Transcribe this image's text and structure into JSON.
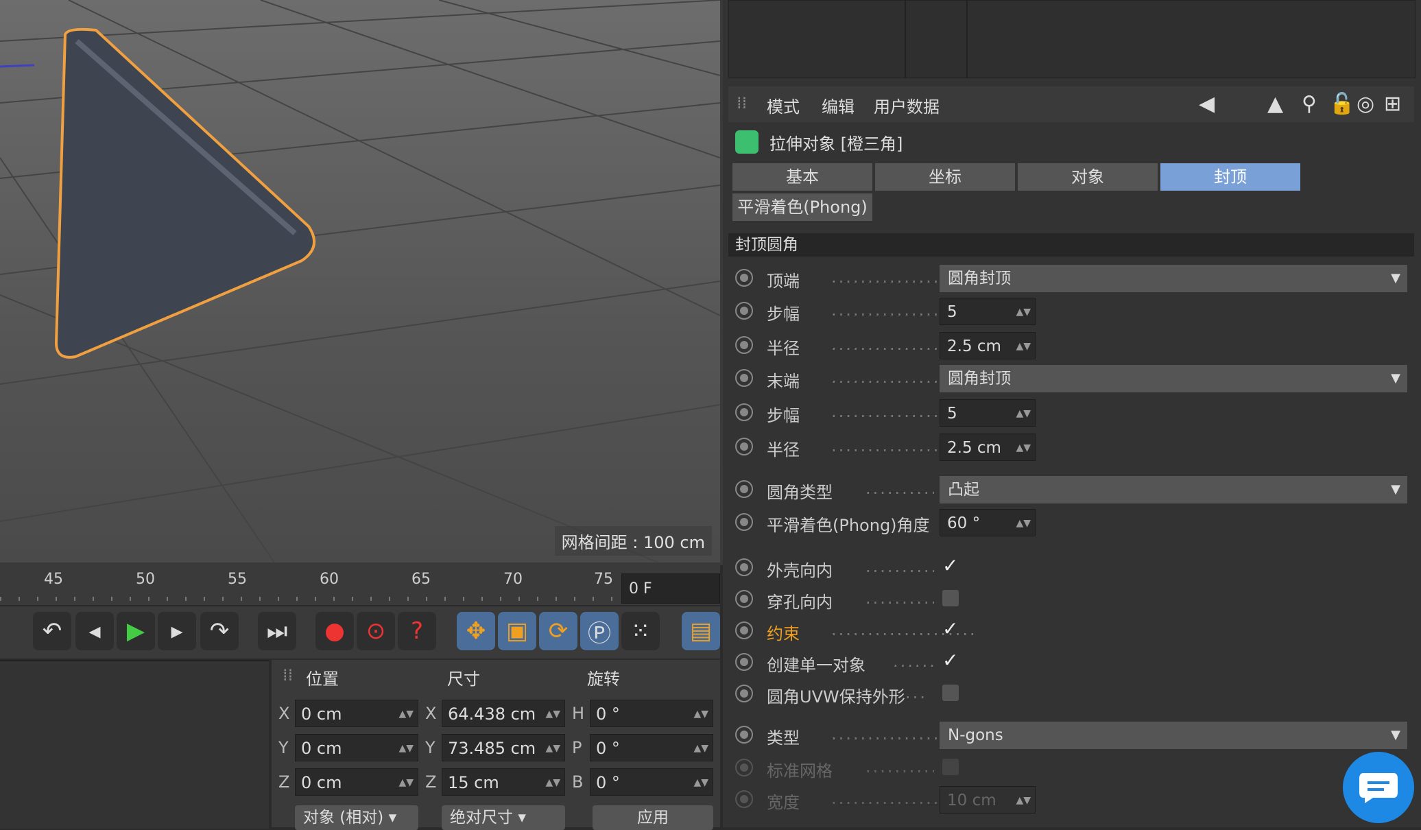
{
  "viewport": {
    "grid_spacing": "网格间距 : 100 cm"
  },
  "timeline": {
    "ticks": [
      "45",
      "50",
      "55",
      "60",
      "65",
      "70",
      "75"
    ],
    "frame": "0 F"
  },
  "coord": {
    "headers": {
      "position": "位置",
      "size": "尺寸",
      "rotation": "旋转"
    },
    "axes_pos": [
      "X",
      "Y",
      "Z"
    ],
    "axes_rot": [
      "H",
      "P",
      "B"
    ],
    "position": [
      "0 cm",
      "0 cm",
      "0 cm"
    ],
    "size": [
      "64.438 cm",
      "73.485 cm",
      "15 cm"
    ],
    "rotation": [
      "0 °",
      "0 °",
      "0 °"
    ],
    "mode_dropdown": "对象 (相对)",
    "size_dropdown": "绝对尺寸",
    "apply": "应用"
  },
  "attr": {
    "menu": [
      "模式",
      "编辑",
      "用户数据"
    ],
    "object_title": "拉伸对象 [橙三角]",
    "tabs": [
      "基本",
      "坐标",
      "对象",
      "封顶",
      "平滑着色(Phong)"
    ],
    "section": "封顶圆角",
    "rows": {
      "start_label": "顶端",
      "start_value": "圆角封顶",
      "steps1_label": "步幅",
      "steps1_value": "5",
      "radius1_label": "半径",
      "radius1_value": "2.5 cm",
      "end_label": "末端",
      "end_value": "圆角封顶",
      "steps2_label": "步幅",
      "steps2_value": "5",
      "radius2_label": "半径",
      "radius2_value": "2.5 cm",
      "filet_type_label": "圆角类型",
      "filet_type_value": "凸起",
      "phong_label": "平滑着色(Phong)角度",
      "phong_value": "60 °",
      "hull_label": "外壳向内",
      "hole_label": "穿孔向内",
      "constrain_label": "约束",
      "single_label": "创建单一对象",
      "uvw_label": "圆角UVW保持外形",
      "type_label": "类型",
      "type_value": "N-gons",
      "std_grid_label": "标准网格",
      "width_label": "宽度",
      "width_value": "10 cm"
    }
  },
  "colors": {
    "accent_tab": "#7aa0d8",
    "highlight_label": "#f0a020",
    "object_outline": "#f0a040",
    "chat": "#1e88e5"
  }
}
